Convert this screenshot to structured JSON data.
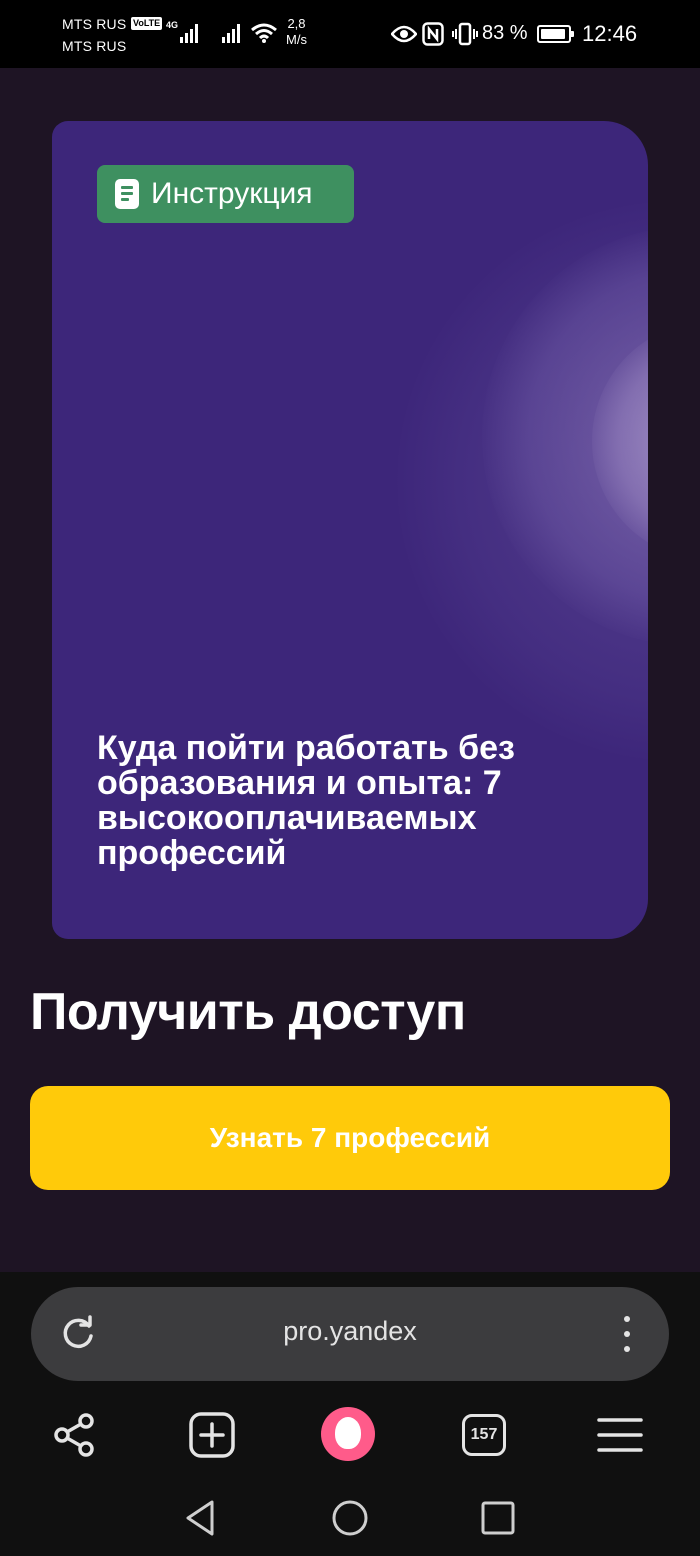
{
  "status_bar": {
    "carrier1": "MTS RUS",
    "carrier2": "MTS RUS",
    "volte": "VoLTE",
    "network": "4G",
    "speed_value": "2,8",
    "speed_unit": "M/s",
    "battery": "83 %",
    "time": "12:46"
  },
  "card": {
    "badge_label": "Инструкция",
    "title": "Куда пойти работать без образования и опыта: 7 высокооплачиваемых профессий",
    "background_color": "#3d267a",
    "badge_color": "#3e9060"
  },
  "main": {
    "access_title": "Получить доступ",
    "cta_label": "Узнать 7 профессий",
    "cta_color": "#ffca0a"
  },
  "browser": {
    "url": "pro.yandex",
    "tabs_count": "157",
    "alice_color": "#ff5b8a"
  }
}
